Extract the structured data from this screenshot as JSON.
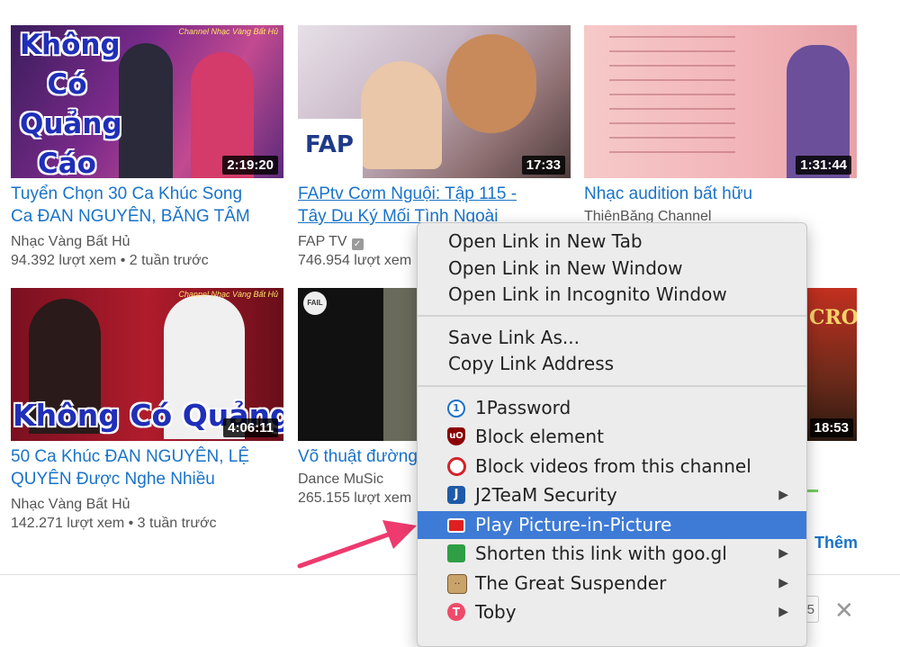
{
  "videos": [
    {
      "duration": "2:19:20",
      "title_line1": "Tuyển Chọn 30 Ca Khúc Song",
      "title_line2": "Ca ĐAN NGUYÊN, BĂNG TÂM",
      "channel": "Nhạc Vàng Bất Hủ",
      "stats": "94.392 lượt xem • 2 tuần trước",
      "overlay": [
        "Không",
        "Có",
        "Quảng",
        "Cáo"
      ],
      "watermark": "Channel Nhạc Vàng Bất Hủ"
    },
    {
      "duration": "17:33",
      "title_line1": "FAPtv Cơm Nguội: Tập 115 -",
      "title_line2": "Tây Du Ký Mối Tình Ngoài",
      "channel": "FAP TV",
      "stats": "746.954 lượt xem",
      "logo": "FAP"
    },
    {
      "duration": "1:31:44",
      "title_line1": "Nhạc audition bất hữu",
      "channel": "ThiênBăng Channel"
    },
    {
      "duration": "4:06:11",
      "title_line1": "50 Ca Khúc ĐAN NGUYÊN, LỆ",
      "title_line2": "QUYÊN Được Nghe Nhiều",
      "channel": "Nhạc Vàng Bất Hủ",
      "stats": "142.271 lượt xem • 3 tuần trước",
      "overlay_line": "Không Có Quảng Cáo",
      "watermark": "Channel Nhạc Vàng Bất Hủ"
    },
    {
      "title_line1": "Võ thuật đường",
      "channel": "Dance MuSic",
      "stats": "265.155 lượt xem",
      "badge": "FAIL"
    },
    {
      "duration": "18:53",
      "overlay": "CRO"
    }
  ],
  "context_menu": {
    "items": [
      {
        "label": "Open Link in New Tab"
      },
      {
        "label": "Open Link in New Window"
      },
      {
        "label": "Open Link in Incognito Window"
      },
      {
        "label": "Save Link As..."
      },
      {
        "label": "Copy Link Address"
      },
      {
        "label": "1Password",
        "icon": "1password-icon",
        "color": "#1a73c8"
      },
      {
        "label": "Block element",
        "icon": "ublock-icon",
        "color": "#8b0000"
      },
      {
        "label": "Block videos from this channel",
        "icon": "block-icon",
        "color": "#d3222a"
      },
      {
        "label": "J2TeaM Security",
        "icon": "j2team-icon",
        "color": "#1e5aa8",
        "submenu": "▶"
      },
      {
        "label": "Play Picture-in-Picture",
        "icon": "pip-icon",
        "color": "#e02020"
      },
      {
        "label": "Shorten this link with goo.gl",
        "icon": "googl-icon",
        "color": "#2f9e44",
        "submenu": "▶"
      },
      {
        "label": "The Great Suspender",
        "icon": "suspender-icon",
        "color": "#c9a46a",
        "submenu": "▶"
      },
      {
        "label": "Toby",
        "icon": "toby-icon",
        "color": "#ee4b6a",
        "submenu": "▶"
      }
    ]
  },
  "show_more": "Thêm",
  "close_glyph": "✕",
  "partial_count": "5",
  "colors": {
    "link_blue": "#1a73c8",
    "menu_highlight": "#3e7bd6",
    "arrow_pink": "#ee3a6e"
  }
}
